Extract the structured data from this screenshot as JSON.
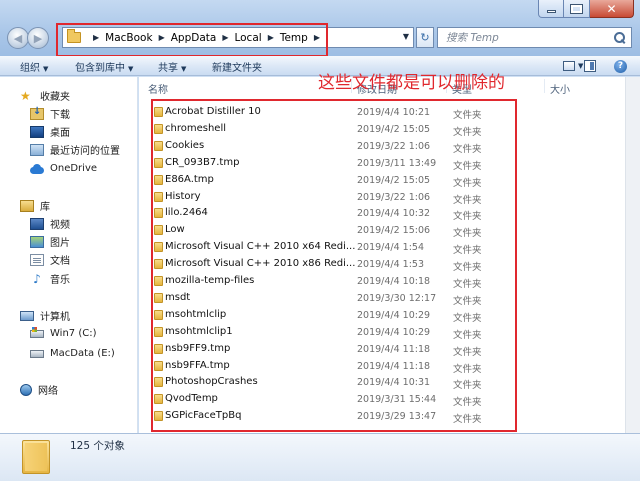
{
  "address": {
    "crumbs": [
      "MacBook",
      "AppData",
      "Local",
      "Temp"
    ],
    "search_placeholder": "搜索 Temp"
  },
  "toolbar": {
    "organize": "组织",
    "include_library": "包含到库中",
    "share": "共享",
    "new_folder": "新建文件夹"
  },
  "nav": {
    "favorites": "收藏夹",
    "downloads": "下载",
    "desktop": "桌面",
    "recent": "最近访问的位置",
    "onedrive": "OneDrive",
    "libraries": "库",
    "videos": "视频",
    "pictures": "图片",
    "documents": "文档",
    "music": "音乐",
    "computer": "计算机",
    "drive_c": "Win7 (C:)",
    "drive_e": "MacData (E:)",
    "network": "网络"
  },
  "columns": {
    "name": "名称",
    "date": "修改日期",
    "type": "类型",
    "size": "大小"
  },
  "files": [
    {
      "name": "Acrobat Distiller 10",
      "date": "2019/4/4 10:21",
      "type": "文件夹"
    },
    {
      "name": "chromeshell",
      "date": "2019/4/2 15:05",
      "type": "文件夹"
    },
    {
      "name": "Cookies",
      "date": "2019/3/22 1:06",
      "type": "文件夹"
    },
    {
      "name": "CR_093B7.tmp",
      "date": "2019/3/11 13:49",
      "type": "文件夹"
    },
    {
      "name": "E86A.tmp",
      "date": "2019/4/2 15:05",
      "type": "文件夹"
    },
    {
      "name": "History",
      "date": "2019/3/22 1:06",
      "type": "文件夹"
    },
    {
      "name": "lilo.2464",
      "date": "2019/4/4 10:32",
      "type": "文件夹"
    },
    {
      "name": "Low",
      "date": "2019/4/2 15:06",
      "type": "文件夹"
    },
    {
      "name": "Microsoft Visual C++ 2010  x64 Redi...",
      "date": "2019/4/4 1:54",
      "type": "文件夹"
    },
    {
      "name": "Microsoft Visual C++ 2010  x86 Redi...",
      "date": "2019/4/4 1:53",
      "type": "文件夹"
    },
    {
      "name": "mozilla-temp-files",
      "date": "2019/4/4 10:18",
      "type": "文件夹"
    },
    {
      "name": "msdt",
      "date": "2019/3/30 12:17",
      "type": "文件夹"
    },
    {
      "name": "msohtmlclip",
      "date": "2019/4/4 10:29",
      "type": "文件夹"
    },
    {
      "name": "msohtmlclip1",
      "date": "2019/4/4 10:29",
      "type": "文件夹"
    },
    {
      "name": "nsb9FF9.tmp",
      "date": "2019/4/4 11:18",
      "type": "文件夹"
    },
    {
      "name": "nsb9FFA.tmp",
      "date": "2019/4/4 11:18",
      "type": "文件夹"
    },
    {
      "name": "PhotoshopCrashes",
      "date": "2019/4/4 10:31",
      "type": "文件夹"
    },
    {
      "name": "QvodTemp",
      "date": "2019/3/31 15:44",
      "type": "文件夹"
    },
    {
      "name": "SGPicFaceTpBq",
      "date": "2019/3/29 13:47",
      "type": "文件夹"
    }
  ],
  "annotation": "这些文件都是可以删除的",
  "status": {
    "count": "125 个对象"
  },
  "colors": {
    "annotation_red": "#e0282e",
    "folder_yellow": "#e5b53e"
  }
}
